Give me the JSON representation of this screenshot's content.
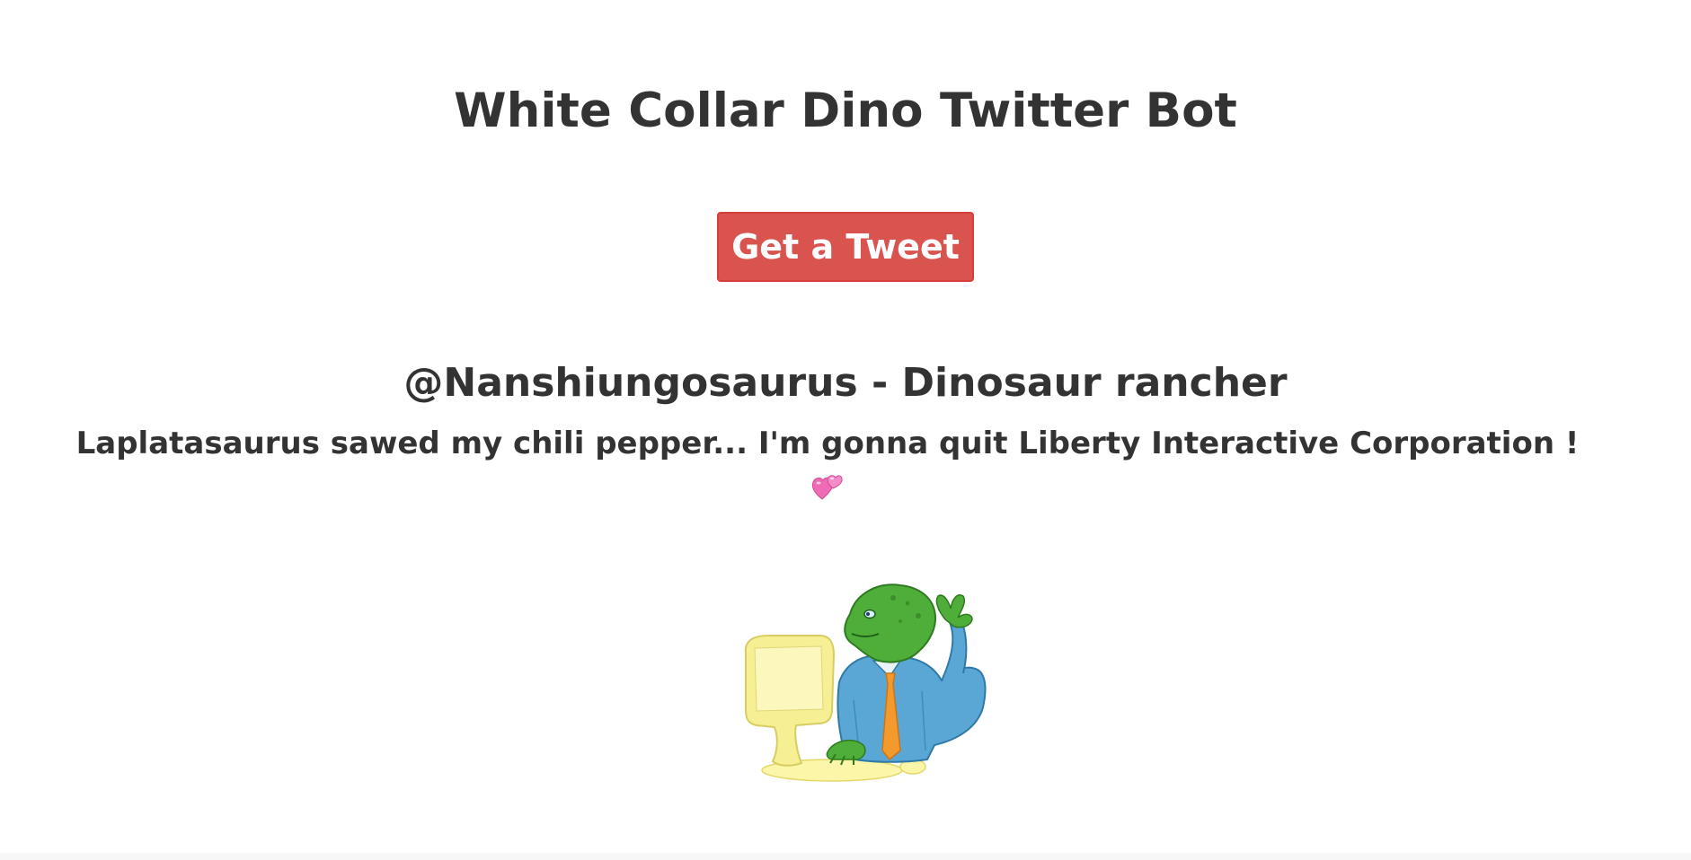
{
  "page": {
    "title": "White Collar Dino Twitter Bot"
  },
  "actions": {
    "get_tweet_label": "Get a Tweet"
  },
  "tweet": {
    "author_line": "@Nanshiungosaurus - Dinosaur rancher",
    "text": "Laplatasaurus sawed my chili pepper... I'm gonna quit Liberty Interactive Corporation !",
    "emoji_icon": "two-hearts-icon"
  },
  "illustration": {
    "icon": "dino-at-computer-illustration"
  },
  "colors": {
    "text": "#333333",
    "button_bg": "#d9534f",
    "button_border": "#d43f3a",
    "button_text": "#ffffff",
    "background": "#ffffff"
  }
}
